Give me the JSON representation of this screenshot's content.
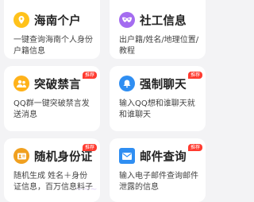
{
  "cards": [
    {
      "title": "海南个户",
      "desc": "一键查询海南个人身份户籍信息",
      "icon": "location-pin-icon",
      "color": "#ffc21b"
    },
    {
      "title": "社工信息",
      "desc": "出户籍/姓名/地理位置/教程",
      "icon": "mask-icon",
      "color": "#a46cf0"
    },
    {
      "title": "突破禁言",
      "desc": "QQ群一键突破禁言发送消息",
      "icon": "group-icon",
      "color": "#ffb21a",
      "badge": "推荐"
    },
    {
      "title": "强制聊天",
      "desc": "输入QQ想和谁聊天就和谁聊天",
      "icon": "bell-icon",
      "color": "#2f8ef2",
      "badge": "推荐"
    },
    {
      "title": "随机身份证",
      "desc": "随机生成 姓名＋身份证信息，百万信息料子",
      "icon": "id-card-icon",
      "color": "#f0a01f",
      "badge": "推荐"
    },
    {
      "title": "邮件查询",
      "desc": "输入电子邮件查询邮件泄露的信息",
      "icon": "mail-icon",
      "color": "#2f8ef2",
      "badge": "推荐"
    }
  ]
}
